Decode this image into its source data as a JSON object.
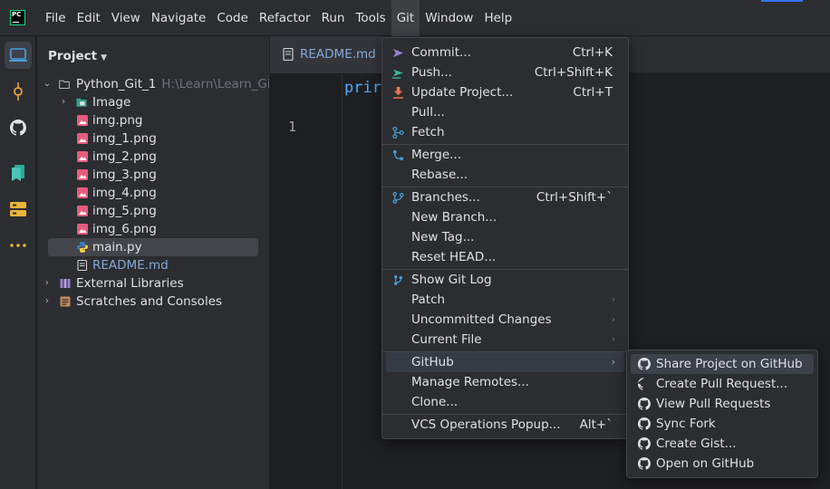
{
  "app": {
    "logo_text": "PC"
  },
  "menubar": {
    "items": [
      "File",
      "Edit",
      "View",
      "Navigate",
      "Code",
      "Refactor",
      "Run",
      "Tools",
      "Git",
      "Window",
      "Help"
    ],
    "active": "Git"
  },
  "toolstrip": {
    "icons": [
      "project-icon",
      "commit-icon",
      "github-icon",
      "bookmarks-icon",
      "structure-icon",
      "more-icon"
    ]
  },
  "project": {
    "header": "Project",
    "tree": [
      {
        "label": "Python_Git_1",
        "path": "H:\\Learn\\Learn_Git_w",
        "type": "root-folder",
        "expanded": true
      },
      {
        "label": "Image",
        "type": "folder",
        "expanded": false
      },
      {
        "label": "img.png",
        "type": "image-file"
      },
      {
        "label": "img_1.png",
        "type": "image-file"
      },
      {
        "label": "img_2.png",
        "type": "image-file"
      },
      {
        "label": "img_3.png",
        "type": "image-file"
      },
      {
        "label": "img_4.png",
        "type": "image-file"
      },
      {
        "label": "img_5.png",
        "type": "image-file"
      },
      {
        "label": "img_6.png",
        "type": "image-file"
      },
      {
        "label": "main.py",
        "type": "python-file",
        "selected": true
      },
      {
        "label": "README.md",
        "type": "markdown-file"
      },
      {
        "label": "External Libraries",
        "type": "libraries",
        "expanded": false
      },
      {
        "label": "Scratches and Consoles",
        "type": "scratches",
        "expanded": false
      }
    ]
  },
  "editor": {
    "tab": "README.md",
    "line_number": "1",
    "code": "prir"
  },
  "git_menu": {
    "groups": [
      [
        {
          "label": "Commit...",
          "shortcut": "Ctrl+K",
          "icon": "commit-arrow-icon"
        },
        {
          "label": "Push...",
          "shortcut": "Ctrl+Shift+K",
          "icon": "push-icon"
        },
        {
          "label": "Update Project...",
          "shortcut": "Ctrl+T",
          "icon": "update-icon"
        },
        {
          "label": "Pull...",
          "shortcut": "",
          "icon": ""
        },
        {
          "label": "Fetch",
          "shortcut": "",
          "icon": "fetch-icon"
        }
      ],
      [
        {
          "label": "Merge...",
          "shortcut": "",
          "icon": "merge-icon"
        },
        {
          "label": "Rebase...",
          "shortcut": "",
          "icon": ""
        }
      ],
      [
        {
          "label": "Branches...",
          "shortcut": "Ctrl+Shift+`",
          "icon": "branch-icon"
        },
        {
          "label": "New Branch...",
          "shortcut": "",
          "icon": ""
        },
        {
          "label": "New Tag...",
          "shortcut": "",
          "icon": ""
        },
        {
          "label": "Reset HEAD...",
          "shortcut": "",
          "icon": ""
        }
      ],
      [
        {
          "label": "Show Git Log",
          "shortcut": "",
          "icon": "git-log-icon"
        },
        {
          "label": "Patch",
          "submenu": true
        },
        {
          "label": "Uncommitted Changes",
          "submenu": true
        },
        {
          "label": "Current File",
          "submenu": true
        }
      ],
      [
        {
          "label": "GitHub",
          "submenu": true,
          "highlighted": true
        },
        {
          "label": "Manage Remotes...",
          "shortcut": ""
        },
        {
          "label": "Clone...",
          "shortcut": ""
        }
      ],
      [
        {
          "label": "VCS Operations Popup...",
          "shortcut": "Alt+`"
        }
      ]
    ]
  },
  "github_menu": {
    "items": [
      {
        "label": "Share Project on GitHub",
        "highlighted": true
      },
      {
        "label": "Create Pull Request..."
      },
      {
        "label": "View Pull Requests"
      },
      {
        "label": "Sync Fork"
      },
      {
        "label": "Create Gist..."
      },
      {
        "label": "Open on GitHub"
      }
    ]
  },
  "colors": {
    "accent": "#3574f0",
    "background": "#1e1f22",
    "panel": "#2b2d30",
    "highlight": "#373b46",
    "file_blue": "#86a8d8",
    "code_blue": "#56a8f5"
  }
}
